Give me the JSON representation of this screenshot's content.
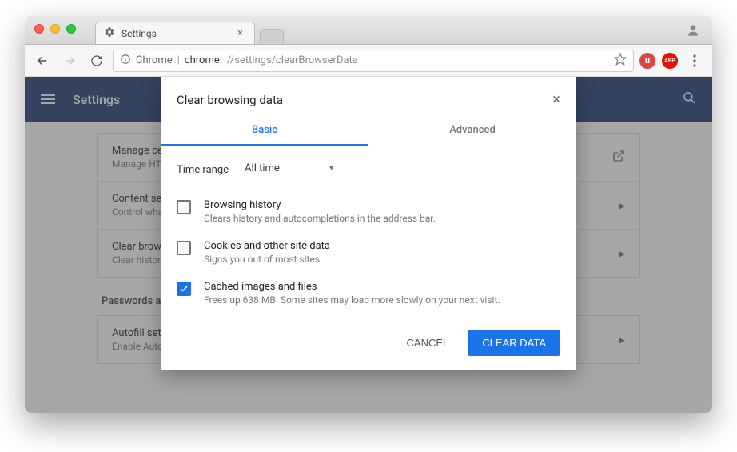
{
  "window": {
    "tab_title": "Settings",
    "tab_icon": "gear-icon"
  },
  "toolbar": {
    "chip_label": "Chrome",
    "url_scheme": "chrome:",
    "url_path": "//settings/clearBrowserData",
    "ext_u_label": "u",
    "ext_abp_label": "ABP"
  },
  "settings_page": {
    "title": "Settings",
    "rows": [
      {
        "title": "Manage ce",
        "sub": "Manage HT",
        "icon": "open-in-new-icon"
      },
      {
        "title": "Content set",
        "sub": "Control wha",
        "icon": "chevron-right-icon"
      },
      {
        "title": "Clear brows",
        "sub": "Clear histor",
        "icon": "chevron-right-icon"
      }
    ],
    "section_label": "Passwords an",
    "rows2": [
      {
        "title": "Autofill sett",
        "sub": "Enable Auto",
        "icon": "chevron-right-icon"
      }
    ]
  },
  "modal": {
    "title": "Clear browsing data",
    "tabs": {
      "basic": "Basic",
      "advanced": "Advanced"
    },
    "time_range_label": "Time range",
    "time_range_value": "All time",
    "items": [
      {
        "checked": false,
        "title": "Browsing history",
        "sub": "Clears history and autocompletions in the address bar."
      },
      {
        "checked": false,
        "title": "Cookies and other site data",
        "sub": "Signs you out of most sites."
      },
      {
        "checked": true,
        "title": "Cached images and files",
        "sub": "Frees up 638 MB. Some sites may load more slowly on your next visit."
      }
    ],
    "cancel_label": "CANCEL",
    "confirm_label": "CLEAR DATA"
  }
}
